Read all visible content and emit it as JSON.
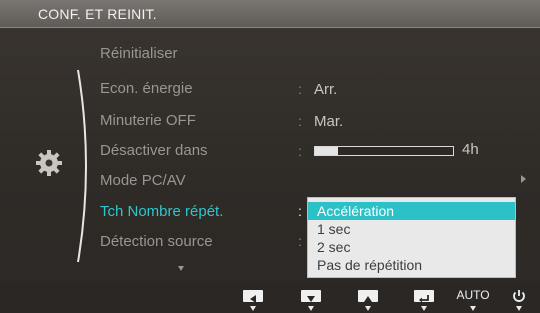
{
  "window": {
    "title": "CONF. ET REINIT."
  },
  "category": {
    "icon": "gear-icon"
  },
  "menu": {
    "items": [
      {
        "label": "Réinitialiser",
        "value": ""
      },
      {
        "label": "Econ. énergie",
        "value": "Arr."
      },
      {
        "label": "Minuterie OFF",
        "value": "Mar."
      },
      {
        "label": "Désactiver dans",
        "value": ""
      },
      {
        "label": "Mode PC/AV",
        "value": ""
      },
      {
        "label": "Tch Nombre répét.",
        "value": ""
      },
      {
        "label": "Détection source",
        "value": ""
      }
    ],
    "active_item": "Tch Nombre répét.",
    "colon": ":",
    "more_indicator": "chevron-down-icon",
    "submenu_indicator": "chevron-right-icon"
  },
  "off_timer": {
    "slider_label": "4h",
    "level_fraction": 0.17
  },
  "dropdown": {
    "options": [
      "Accélération",
      "1 sec",
      "2 sec",
      "Pas de répétition"
    ],
    "selected": "Accélération"
  },
  "buttons": {
    "left": "left-arrow-icon",
    "down": "down-arrow-icon",
    "up": "up-arrow-icon",
    "enter": "enter-icon",
    "auto_label": "AUTO",
    "power": "power-icon"
  },
  "colors": {
    "accent": "#2fc6cc",
    "selected_option_bg": "#2cc1c7",
    "dropdown_bg": "#e9e9e9"
  }
}
